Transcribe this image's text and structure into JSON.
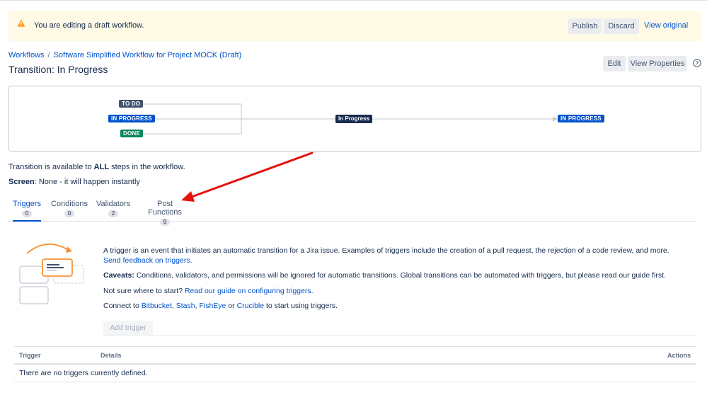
{
  "banner": {
    "message": "You are editing a draft workflow.",
    "publish_label": "Publish",
    "discard_label": "Discard",
    "view_original_label": "View original"
  },
  "breadcrumb": {
    "root": "Workflows",
    "separator": "/",
    "current": "Software Simplified Workflow for Project MOCK (Draft)"
  },
  "page": {
    "title": "Transition: In Progress",
    "edit_label": "Edit",
    "view_properties_label": "View Properties"
  },
  "diagram": {
    "from_statuses": [
      "TO DO",
      "IN PROGRESS",
      "DONE"
    ],
    "transition_name": "In Progress",
    "to_status": "IN PROGRESS"
  },
  "info": {
    "available_prefix": "Transition is available to ",
    "available_bold": "ALL",
    "available_suffix": " steps in the workflow.",
    "screen_label": "Screen",
    "screen_value": ": None - it will happen instantly"
  },
  "tabs": [
    {
      "label": "Triggers",
      "count": "0",
      "active": true
    },
    {
      "label": "Conditions",
      "count": "0",
      "active": false
    },
    {
      "label": "Validators",
      "count": "2",
      "active": false
    },
    {
      "label": "Post Functions",
      "count": "9",
      "active": false
    }
  ],
  "triggers": {
    "intro": "A trigger is an event that initiates an automatic transition for a Jira issue. Examples of triggers include the creation of a pull request, the rejection of a code review, and more. ",
    "intro_link": "Send feedback on triggers.",
    "caveats_label": "Caveats:",
    "caveats_text": " Conditions, validators, and permissions will be ignored for automatic transitions. Global transitions can be automated with triggers, but please read our guide first.",
    "start_text": "Not sure where to start? ",
    "start_link": "Read our guide on configuring triggers.",
    "connect_prefix": "Connect to ",
    "connect_bitbucket": "Bitbucket",
    "connect_comma1": ", ",
    "connect_stash": "Stash",
    "connect_comma2": ", ",
    "connect_fisheye": "FishEye",
    "connect_or": " or ",
    "connect_crucible": "Crucible",
    "connect_suffix": " to start using triggers.",
    "add_label": "Add trigger"
  },
  "table": {
    "col_trigger": "Trigger",
    "col_details": "Details",
    "col_actions": "Actions",
    "empty_message": "There are no triggers currently defined."
  },
  "colors": {
    "accent": "#0052cc",
    "banner_bg": "#fffae6",
    "todo": "#42526e",
    "inprogress": "#0052cc",
    "done": "#00875a",
    "annotation_arrow": "#e3120b"
  }
}
